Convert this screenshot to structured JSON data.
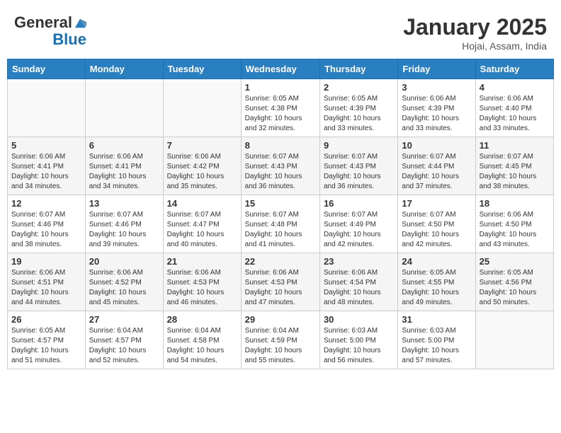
{
  "header": {
    "logo_general": "General",
    "logo_blue": "Blue",
    "month_title": "January 2025",
    "location": "Hojai, Assam, India"
  },
  "days_of_week": [
    "Sunday",
    "Monday",
    "Tuesday",
    "Wednesday",
    "Thursday",
    "Friday",
    "Saturday"
  ],
  "weeks": [
    [
      {
        "day": "",
        "info": ""
      },
      {
        "day": "",
        "info": ""
      },
      {
        "day": "",
        "info": ""
      },
      {
        "day": "1",
        "info": "Sunrise: 6:05 AM\nSunset: 4:38 PM\nDaylight: 10 hours\nand 32 minutes."
      },
      {
        "day": "2",
        "info": "Sunrise: 6:05 AM\nSunset: 4:39 PM\nDaylight: 10 hours\nand 33 minutes."
      },
      {
        "day": "3",
        "info": "Sunrise: 6:06 AM\nSunset: 4:39 PM\nDaylight: 10 hours\nand 33 minutes."
      },
      {
        "day": "4",
        "info": "Sunrise: 6:06 AM\nSunset: 4:40 PM\nDaylight: 10 hours\nand 33 minutes."
      }
    ],
    [
      {
        "day": "5",
        "info": "Sunrise: 6:06 AM\nSunset: 4:41 PM\nDaylight: 10 hours\nand 34 minutes."
      },
      {
        "day": "6",
        "info": "Sunrise: 6:06 AM\nSunset: 4:41 PM\nDaylight: 10 hours\nand 34 minutes."
      },
      {
        "day": "7",
        "info": "Sunrise: 6:06 AM\nSunset: 4:42 PM\nDaylight: 10 hours\nand 35 minutes."
      },
      {
        "day": "8",
        "info": "Sunrise: 6:07 AM\nSunset: 4:43 PM\nDaylight: 10 hours\nand 36 minutes."
      },
      {
        "day": "9",
        "info": "Sunrise: 6:07 AM\nSunset: 4:43 PM\nDaylight: 10 hours\nand 36 minutes."
      },
      {
        "day": "10",
        "info": "Sunrise: 6:07 AM\nSunset: 4:44 PM\nDaylight: 10 hours\nand 37 minutes."
      },
      {
        "day": "11",
        "info": "Sunrise: 6:07 AM\nSunset: 4:45 PM\nDaylight: 10 hours\nand 38 minutes."
      }
    ],
    [
      {
        "day": "12",
        "info": "Sunrise: 6:07 AM\nSunset: 4:46 PM\nDaylight: 10 hours\nand 38 minutes."
      },
      {
        "day": "13",
        "info": "Sunrise: 6:07 AM\nSunset: 4:46 PM\nDaylight: 10 hours\nand 39 minutes."
      },
      {
        "day": "14",
        "info": "Sunrise: 6:07 AM\nSunset: 4:47 PM\nDaylight: 10 hours\nand 40 minutes."
      },
      {
        "day": "15",
        "info": "Sunrise: 6:07 AM\nSunset: 4:48 PM\nDaylight: 10 hours\nand 41 minutes."
      },
      {
        "day": "16",
        "info": "Sunrise: 6:07 AM\nSunset: 4:49 PM\nDaylight: 10 hours\nand 42 minutes."
      },
      {
        "day": "17",
        "info": "Sunrise: 6:07 AM\nSunset: 4:50 PM\nDaylight: 10 hours\nand 42 minutes."
      },
      {
        "day": "18",
        "info": "Sunrise: 6:06 AM\nSunset: 4:50 PM\nDaylight: 10 hours\nand 43 minutes."
      }
    ],
    [
      {
        "day": "19",
        "info": "Sunrise: 6:06 AM\nSunset: 4:51 PM\nDaylight: 10 hours\nand 44 minutes."
      },
      {
        "day": "20",
        "info": "Sunrise: 6:06 AM\nSunset: 4:52 PM\nDaylight: 10 hours\nand 45 minutes."
      },
      {
        "day": "21",
        "info": "Sunrise: 6:06 AM\nSunset: 4:53 PM\nDaylight: 10 hours\nand 46 minutes."
      },
      {
        "day": "22",
        "info": "Sunrise: 6:06 AM\nSunset: 4:53 PM\nDaylight: 10 hours\nand 47 minutes."
      },
      {
        "day": "23",
        "info": "Sunrise: 6:06 AM\nSunset: 4:54 PM\nDaylight: 10 hours\nand 48 minutes."
      },
      {
        "day": "24",
        "info": "Sunrise: 6:05 AM\nSunset: 4:55 PM\nDaylight: 10 hours\nand 49 minutes."
      },
      {
        "day": "25",
        "info": "Sunrise: 6:05 AM\nSunset: 4:56 PM\nDaylight: 10 hours\nand 50 minutes."
      }
    ],
    [
      {
        "day": "26",
        "info": "Sunrise: 6:05 AM\nSunset: 4:57 PM\nDaylight: 10 hours\nand 51 minutes."
      },
      {
        "day": "27",
        "info": "Sunrise: 6:04 AM\nSunset: 4:57 PM\nDaylight: 10 hours\nand 52 minutes."
      },
      {
        "day": "28",
        "info": "Sunrise: 6:04 AM\nSunset: 4:58 PM\nDaylight: 10 hours\nand 54 minutes."
      },
      {
        "day": "29",
        "info": "Sunrise: 6:04 AM\nSunset: 4:59 PM\nDaylight: 10 hours\nand 55 minutes."
      },
      {
        "day": "30",
        "info": "Sunrise: 6:03 AM\nSunset: 5:00 PM\nDaylight: 10 hours\nand 56 minutes."
      },
      {
        "day": "31",
        "info": "Sunrise: 6:03 AM\nSunset: 5:00 PM\nDaylight: 10 hours\nand 57 minutes."
      },
      {
        "day": "",
        "info": ""
      }
    ]
  ]
}
